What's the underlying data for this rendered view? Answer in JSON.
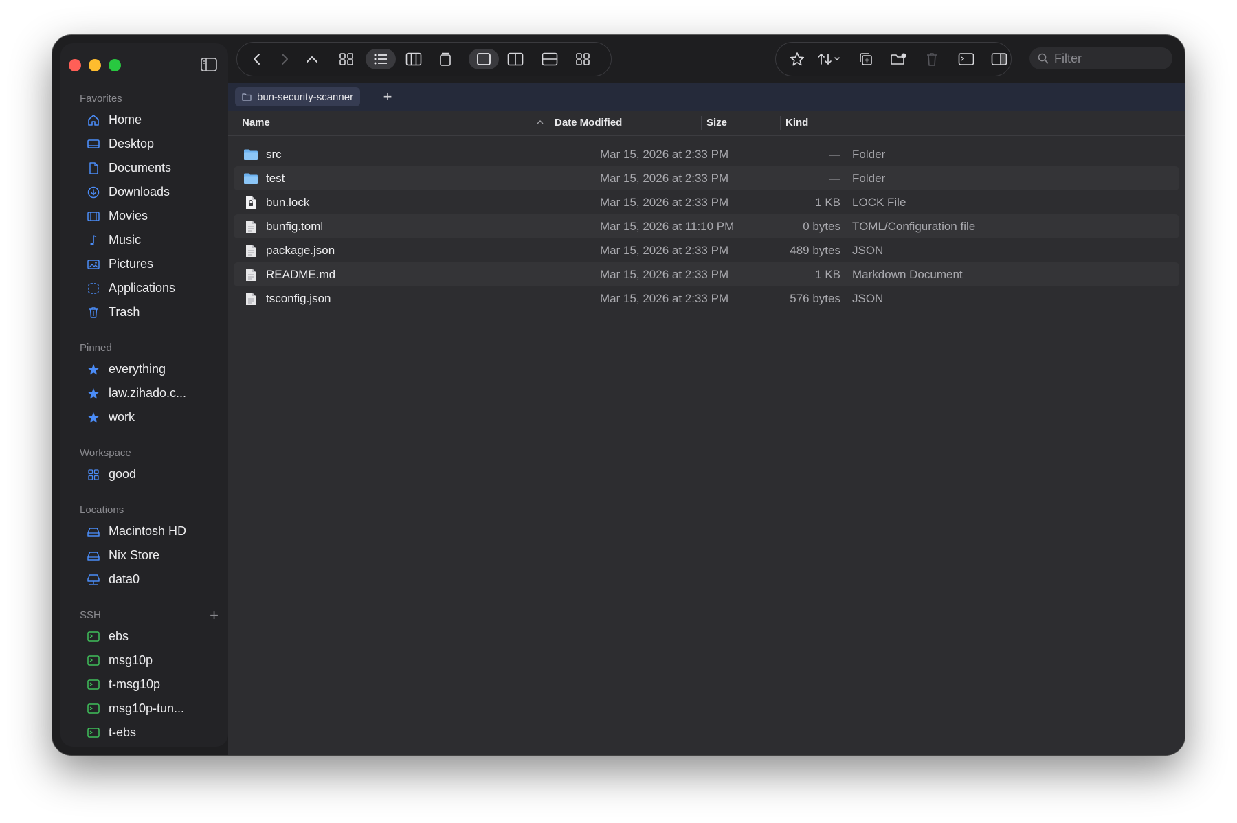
{
  "window": {
    "traffic_lights": {
      "close": "#ff5f57",
      "minimize": "#febc2e",
      "zoom": "#28c840"
    }
  },
  "sidebar": {
    "sections": [
      {
        "title": "Favorites",
        "items": [
          {
            "label": "Home",
            "icon": "house-icon"
          },
          {
            "label": "Desktop",
            "icon": "desktop-icon"
          },
          {
            "label": "Documents",
            "icon": "document-icon"
          },
          {
            "label": "Downloads",
            "icon": "download-icon"
          },
          {
            "label": "Movies",
            "icon": "film-icon"
          },
          {
            "label": "Music",
            "icon": "music-note-icon"
          },
          {
            "label": "Pictures",
            "icon": "photo-icon"
          },
          {
            "label": "Applications",
            "icon": "applications-icon"
          },
          {
            "label": "Trash",
            "icon": "trash-icon"
          }
        ]
      },
      {
        "title": "Pinned",
        "items": [
          {
            "label": "everything",
            "icon": "star-icon"
          },
          {
            "label": "law.zihado.c...",
            "icon": "star-icon"
          },
          {
            "label": "work",
            "icon": "star-icon"
          }
        ]
      },
      {
        "title": "Workspace",
        "items": [
          {
            "label": "good",
            "icon": "grid-icon"
          }
        ]
      },
      {
        "title": "Locations",
        "items": [
          {
            "label": "Macintosh HD",
            "icon": "drive-icon"
          },
          {
            "label": "Nix Store",
            "icon": "drive-icon"
          },
          {
            "label": "data0",
            "icon": "network-drive-icon"
          }
        ]
      },
      {
        "title": "SSH",
        "add_label": "+",
        "items": [
          {
            "label": "ebs",
            "icon": "terminal-icon"
          },
          {
            "label": "msg10p",
            "icon": "terminal-icon"
          },
          {
            "label": "t-msg10p",
            "icon": "terminal-icon"
          },
          {
            "label": "msg10p-tun...",
            "icon": "terminal-icon"
          },
          {
            "label": "t-ebs",
            "icon": "terminal-icon"
          }
        ]
      }
    ]
  },
  "toolbar": {
    "filter_placeholder": "Filter"
  },
  "tabs": {
    "items": [
      {
        "label": "bun-security-scanner"
      }
    ],
    "add_label": "+"
  },
  "file_list": {
    "columns": {
      "name": "Name",
      "date": "Date Modified",
      "size": "Size",
      "kind": "Kind"
    },
    "rows": [
      {
        "name": "src",
        "date": "Mar 15, 2026 at 2:33 PM",
        "size": "—",
        "kind": "Folder",
        "type": "folder"
      },
      {
        "name": "test",
        "date": "Mar 15, 2026 at 2:33 PM",
        "size": "—",
        "kind": "Folder",
        "type": "folder"
      },
      {
        "name": "bun.lock",
        "date": "Mar 15, 2026 at 2:33 PM",
        "size": "1 KB",
        "kind": "LOCK File",
        "type": "lock"
      },
      {
        "name": "bunfig.toml",
        "date": "Mar 15, 2026 at 11:10 PM",
        "size": "0 bytes",
        "kind": "TOML/Configuration file",
        "type": "file"
      },
      {
        "name": "package.json",
        "date": "Mar 15, 2026 at 2:33 PM",
        "size": "489 bytes",
        "kind": "JSON",
        "type": "file"
      },
      {
        "name": "README.md",
        "date": "Mar 15, 2026 at 2:33 PM",
        "size": "1 KB",
        "kind": "Markdown Document",
        "type": "file"
      },
      {
        "name": "tsconfig.json",
        "date": "Mar 15, 2026 at 2:33 PM",
        "size": "576 bytes",
        "kind": "JSON",
        "type": "file"
      }
    ]
  },
  "colors": {
    "accent": "#4b8cf7",
    "ssh_icon": "#3fbf5a",
    "folder": "#6eb2ef"
  }
}
